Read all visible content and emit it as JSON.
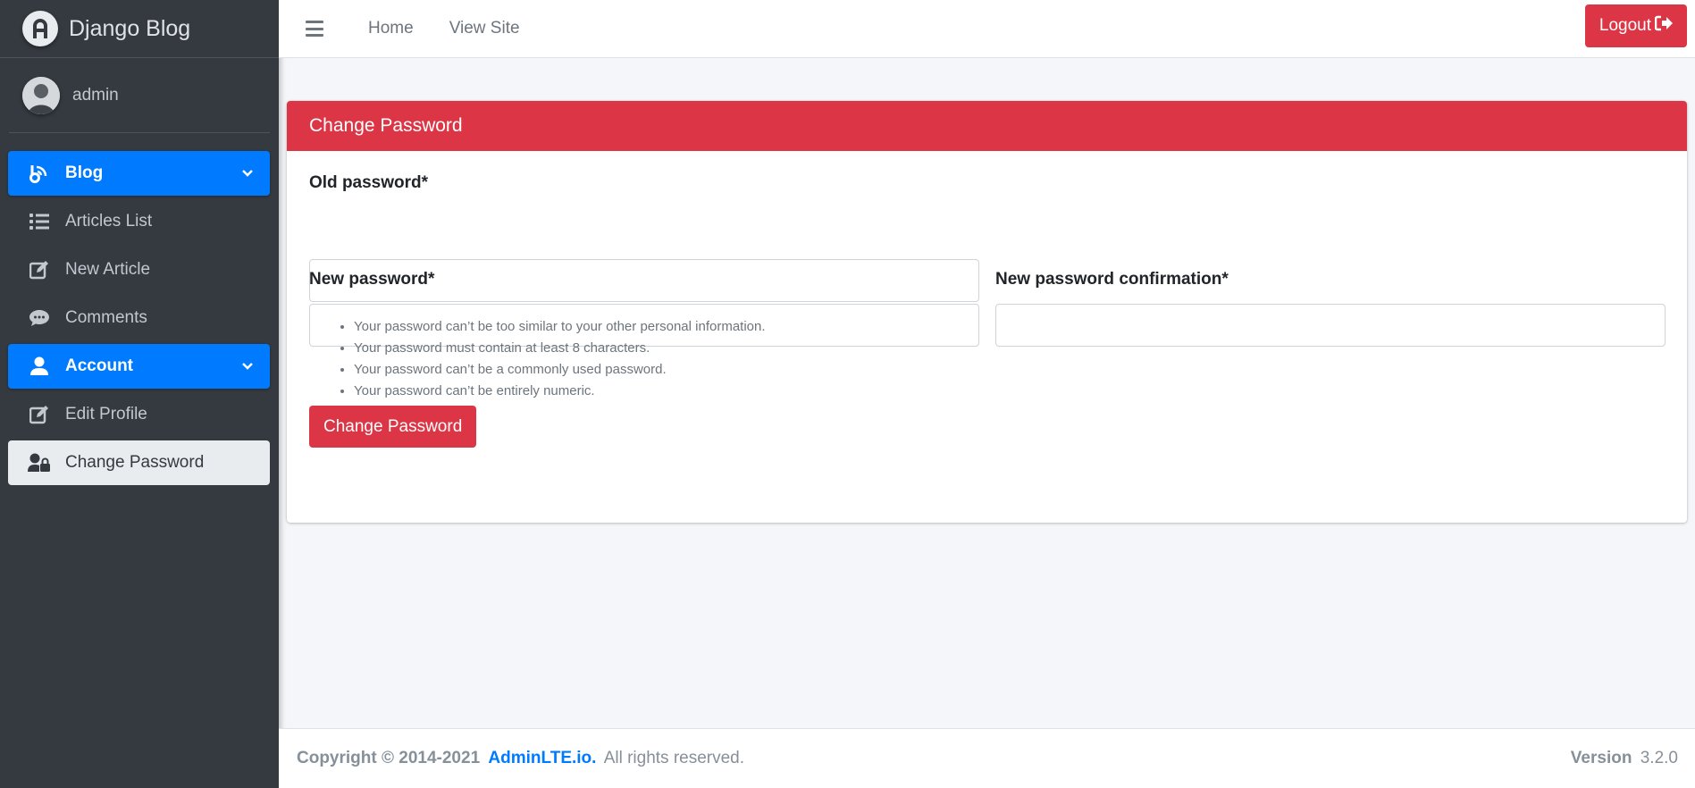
{
  "brand": {
    "name": "Django Blog"
  },
  "user": {
    "name": "admin"
  },
  "sidebar": {
    "items": [
      {
        "label": "Blog",
        "icon": "blog-icon"
      },
      {
        "label": "Articles List",
        "icon": "list-icon"
      },
      {
        "label": "New Article",
        "icon": "edit-icon"
      },
      {
        "label": "Comments",
        "icon": "comment-icon"
      },
      {
        "label": "Account",
        "icon": "user-icon"
      },
      {
        "label": "Edit Profile",
        "icon": "edit-icon"
      },
      {
        "label": "Change Password",
        "icon": "user-lock-icon"
      }
    ]
  },
  "topbar": {
    "home": "Home",
    "view_site": "View Site",
    "logout": "Logout"
  },
  "card": {
    "title": "Change Password",
    "old_password_label": "Old password*",
    "new_password_label": "New password*",
    "confirm_password_label": "New password confirmation*",
    "old_password_value": "",
    "new_password_value": "",
    "confirm_password_value": "",
    "help": [
      "Your password can’t be too similar to your other personal information.",
      "Your password must contain at least 8 characters.",
      "Your password can’t be a commonly used password.",
      "Your password can’t be entirely numeric."
    ],
    "submit": "Change Password"
  },
  "footer": {
    "copyright": "Copyright © 2014-2021",
    "link": "AdminLTE.io.",
    "rights": "All rights reserved.",
    "version_label": "Version",
    "version": "3.2.0"
  },
  "colors": {
    "sidebar_bg": "#343a40",
    "primary": "#007bff",
    "danger": "#dc3545",
    "page_bg": "#f4f6f9"
  }
}
